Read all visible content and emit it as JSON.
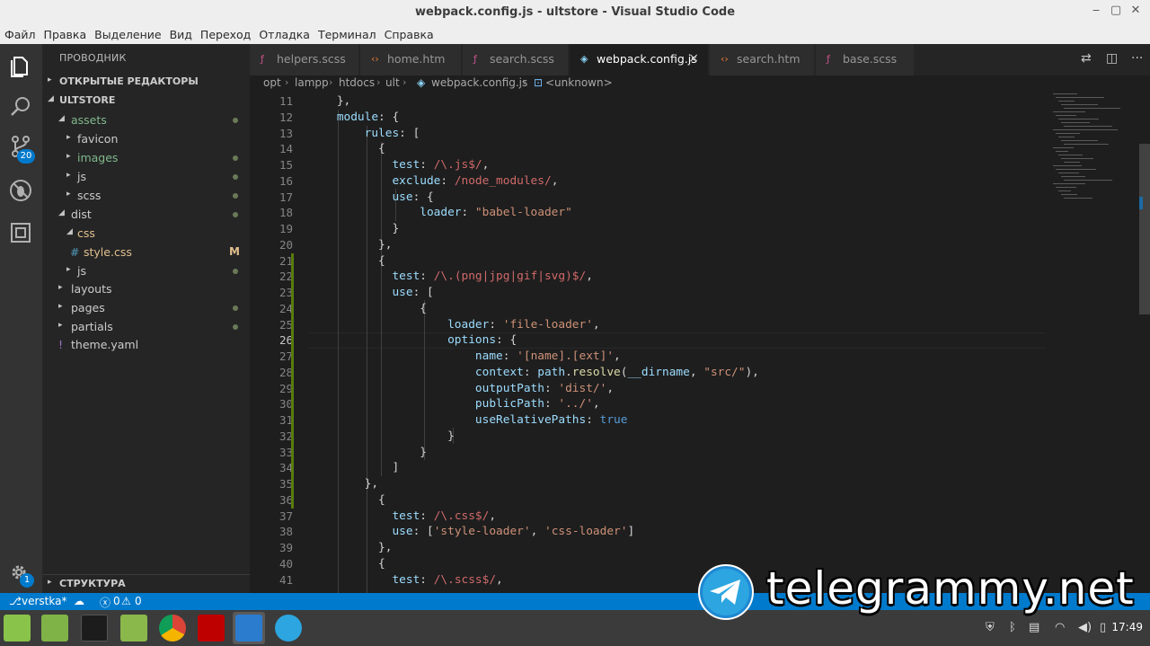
{
  "window": {
    "title": "webpack.config.js - ultstore - Visual Studio Code",
    "controls": {
      "minimize": "‒",
      "maximize": "▢",
      "close": "✕"
    }
  },
  "menu": [
    "Файл",
    "Правка",
    "Выделение",
    "Вид",
    "Переход",
    "Отладка",
    "Терминал",
    "Справка"
  ],
  "activity_bar": {
    "items": [
      "explorer-icon",
      "search-icon",
      "source-control-icon",
      "debug-icon",
      "extensions-icon"
    ],
    "source_control_badge": "20",
    "settings_badge": "1"
  },
  "sidebar": {
    "title": "ПРОВОДНИК",
    "open_editors": "ОТКРЫТЫЕ РЕДАКТОРЫ",
    "root": "ULTSTORE",
    "outline": "СТРУКТУРА",
    "tree": [
      {
        "label": "assets",
        "twisty": "◢",
        "dot": true
      },
      {
        "label": "favicon",
        "twisty": "▸",
        "dot": false
      },
      {
        "label": "images",
        "twisty": "▸",
        "dot": true
      },
      {
        "label": "js",
        "twisty": "▸",
        "dot": true
      },
      {
        "label": "scss",
        "twisty": "▸",
        "dot": true
      },
      {
        "label": "dist",
        "twisty": "◢",
        "dot": true
      },
      {
        "label": "css",
        "twisty": "◢",
        "dot": false
      },
      {
        "label": "style.css",
        "icon": "#",
        "flag": "M"
      },
      {
        "label": "js",
        "twisty": "▸",
        "dot": true
      },
      {
        "label": "layouts",
        "twisty": "▸",
        "dot": false
      },
      {
        "label": "pages",
        "twisty": "▸",
        "dot": true
      },
      {
        "label": "partials",
        "twisty": "▸",
        "dot": true
      },
      {
        "label": "theme.yaml",
        "icon": "!",
        "dot": false
      }
    ]
  },
  "tabs": [
    {
      "label": "helpers.scss",
      "icon": "scss-icon",
      "active": false
    },
    {
      "label": "home.htm",
      "icon": "html-icon",
      "active": false
    },
    {
      "label": "search.scss",
      "icon": "scss-icon",
      "active": false
    },
    {
      "label": "webpack.config.js",
      "icon": "webpack-icon",
      "active": true,
      "close": "×"
    },
    {
      "label": "search.htm",
      "icon": "html-icon",
      "active": false
    },
    {
      "label": "base.scss",
      "icon": "scss-icon",
      "active": false
    }
  ],
  "breadcrumb": [
    "opt",
    "lampp",
    "htdocs",
    "ult",
    "webpack.config.js",
    "<unknown>"
  ],
  "code": {
    "current_line": 26,
    "lines": [
      {
        "n": 11,
        "tokens": [
          [
            "p",
            "    },"
          ]
        ]
      },
      {
        "n": 12,
        "tokens": [
          [
            "k",
            "    module"
          ],
          [
            "p",
            ": {"
          ]
        ]
      },
      {
        "n": 13,
        "tokens": [
          [
            "k",
            "        rules"
          ],
          [
            "p",
            ": ["
          ]
        ]
      },
      {
        "n": 14,
        "tokens": [
          [
            "p",
            "          {"
          ]
        ]
      },
      {
        "n": 15,
        "tokens": [
          [
            "k",
            "            test"
          ],
          [
            "p",
            ": "
          ],
          [
            "r",
            "/\\.js$/"
          ],
          [
            "p",
            ","
          ]
        ]
      },
      {
        "n": 16,
        "tokens": [
          [
            "k",
            "            exclude"
          ],
          [
            "p",
            ": "
          ],
          [
            "r",
            "/node_modules/"
          ],
          [
            "p",
            ","
          ]
        ]
      },
      {
        "n": 17,
        "tokens": [
          [
            "k",
            "            use"
          ],
          [
            "p",
            ": {"
          ]
        ]
      },
      {
        "n": 18,
        "tokens": [
          [
            "k",
            "                loader"
          ],
          [
            "p",
            ": "
          ],
          [
            "s",
            "\"babel-loader\""
          ]
        ]
      },
      {
        "n": 19,
        "tokens": [
          [
            "p",
            "            }"
          ]
        ]
      },
      {
        "n": 20,
        "tokens": [
          [
            "p",
            "          },"
          ]
        ]
      },
      {
        "n": 21,
        "tokens": [
          [
            "p",
            "          {"
          ]
        ]
      },
      {
        "n": 22,
        "tokens": [
          [
            "k",
            "            test"
          ],
          [
            "p",
            ": "
          ],
          [
            "r",
            "/\\.(png|jpg|gif|svg)$/"
          ],
          [
            "p",
            ","
          ]
        ]
      },
      {
        "n": 23,
        "tokens": [
          [
            "k",
            "            use"
          ],
          [
            "p",
            ": ["
          ]
        ]
      },
      {
        "n": 24,
        "tokens": [
          [
            "p",
            "                {"
          ]
        ]
      },
      {
        "n": 25,
        "tokens": [
          [
            "k",
            "                    loader"
          ],
          [
            "p",
            ": "
          ],
          [
            "s",
            "'file-loader'"
          ],
          [
            "p",
            ","
          ]
        ]
      },
      {
        "n": 26,
        "tokens": [
          [
            "k",
            "                    options"
          ],
          [
            "p",
            ": {"
          ]
        ]
      },
      {
        "n": 27,
        "tokens": [
          [
            "k",
            "                        name"
          ],
          [
            "p",
            ": "
          ],
          [
            "s",
            "'[name].[ext]'"
          ],
          [
            "p",
            ","
          ]
        ]
      },
      {
        "n": 28,
        "tokens": [
          [
            "k",
            "                        context"
          ],
          [
            "p",
            ": "
          ],
          [
            "k",
            "path"
          ],
          [
            "p",
            "."
          ],
          [
            "f",
            "resolve"
          ],
          [
            "p",
            "("
          ],
          [
            "k",
            "__dirname"
          ],
          [
            "p",
            ", "
          ],
          [
            "s",
            "\"src/\""
          ],
          [
            "p",
            "),"
          ]
        ]
      },
      {
        "n": 29,
        "tokens": [
          [
            "k",
            "                        outputPath"
          ],
          [
            "p",
            ": "
          ],
          [
            "s",
            "'dist/'"
          ],
          [
            "p",
            ","
          ]
        ]
      },
      {
        "n": 30,
        "tokens": [
          [
            "k",
            "                        publicPath"
          ],
          [
            "p",
            ": "
          ],
          [
            "s",
            "'../'"
          ],
          [
            "p",
            ","
          ]
        ]
      },
      {
        "n": 31,
        "tokens": [
          [
            "k",
            "                        useRelativePaths"
          ],
          [
            "p",
            ": "
          ],
          [
            "b",
            "true"
          ]
        ]
      },
      {
        "n": 32,
        "tokens": [
          [
            "p",
            "                    }"
          ]
        ]
      },
      {
        "n": 33,
        "tokens": [
          [
            "p",
            "                }"
          ]
        ]
      },
      {
        "n": 34,
        "tokens": [
          [
            "p",
            "            ]"
          ]
        ]
      },
      {
        "n": 35,
        "tokens": [
          [
            "p",
            "        },"
          ]
        ]
      },
      {
        "n": 36,
        "tokens": [
          [
            "p",
            "          {"
          ]
        ]
      },
      {
        "n": 37,
        "tokens": [
          [
            "k",
            "            test"
          ],
          [
            "p",
            ": "
          ],
          [
            "r",
            "/\\.css$/"
          ],
          [
            "p",
            ","
          ]
        ]
      },
      {
        "n": 38,
        "tokens": [
          [
            "k",
            "            use"
          ],
          [
            "p",
            ": ["
          ],
          [
            "s",
            "'style-loader'"
          ],
          [
            "p",
            ", "
          ],
          [
            "s",
            "'css-loader'"
          ],
          [
            "p",
            "]"
          ]
        ]
      },
      {
        "n": 39,
        "tokens": [
          [
            "p",
            "          },"
          ]
        ]
      },
      {
        "n": 40,
        "tokens": [
          [
            "p",
            "          {"
          ]
        ]
      },
      {
        "n": 41,
        "tokens": [
          [
            "k",
            "            test"
          ],
          [
            "p",
            ": "
          ],
          [
            "r",
            "/\\.scss$/"
          ],
          [
            "p",
            ","
          ]
        ]
      }
    ]
  },
  "status": {
    "branch": "verstka*",
    "sync_icon": "sync-icon",
    "errors": "0",
    "warnings": "0"
  },
  "taskbar": {
    "apps": [
      "mint-menu-icon",
      "files-icon",
      "terminal-icon",
      "folder-icon",
      "chrome-icon",
      "filezilla-icon",
      "vscode-icon",
      "telegram-icon"
    ],
    "clock": "17:49"
  },
  "watermark": "telegrammy.net",
  "colors": {
    "accent": "#007acc",
    "sidebar": "#252526",
    "editor": "#1e1e1e",
    "keyword": "#9cdcfe",
    "string": "#ce9178",
    "regex": "#d16969"
  }
}
